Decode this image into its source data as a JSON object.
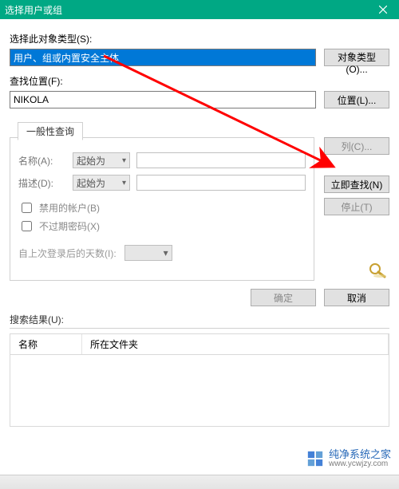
{
  "window": {
    "title": "选择用户或组"
  },
  "section1": {
    "label": "选择此对象类型(S):",
    "value": "用户、组或内置安全主体",
    "button": "对象类型(O)..."
  },
  "section2": {
    "label": "查找位置(F):",
    "value": "NIKOLA",
    "button": "位置(L)..."
  },
  "tab": {
    "label": "一般性查询"
  },
  "query": {
    "name_label": "名称(A):",
    "desc_label": "描述(D):",
    "match_mode": "起始为",
    "name_value": "",
    "desc_value": "",
    "chk_disabled": "禁用的帐户(B)",
    "chk_noexpire": "不过期密码(X)",
    "days_label": "自上次登录后的天数(I):",
    "days_value": ""
  },
  "right_buttons": {
    "columns": "列(C)...",
    "find_now": "立即查找(N)",
    "stop": "停止(T)"
  },
  "bottom": {
    "ok": "确定",
    "cancel": "取消"
  },
  "results": {
    "label": "搜索结果(U):",
    "col_name": "名称",
    "col_folder": "所在文件夹"
  },
  "watermark": {
    "line1": "纯净系统之家",
    "line2": "www.ycwjzy.com"
  },
  "arrow_color": "#ff0000"
}
